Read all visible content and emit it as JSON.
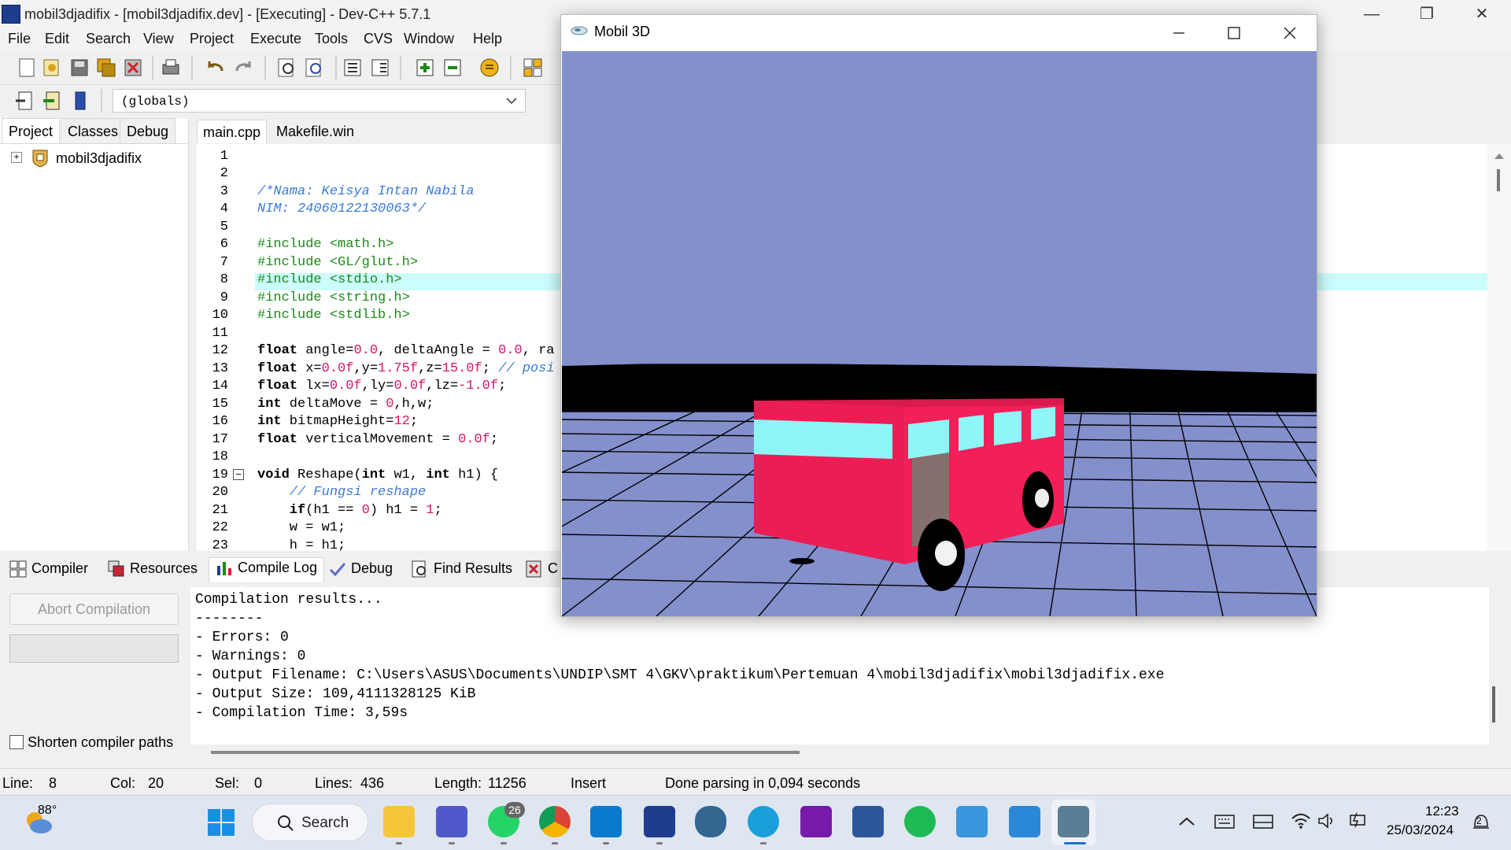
{
  "window": {
    "title": "mobil3djadifix - [mobil3djadifix.dev] - [Executing] - Dev-C++ 5.7.1",
    "minimize_glyph": "—",
    "restore_glyph": "❐",
    "close_glyph": "✕"
  },
  "menu": [
    "File",
    "Edit",
    "Search",
    "View",
    "Project",
    "Execute",
    "Tools",
    "CVS",
    "Window",
    "Help"
  ],
  "toolbar": {
    "globals_value": "(globals)"
  },
  "left_tabs": [
    "Project",
    "Classes",
    "Debug"
  ],
  "project_tree": {
    "root": "mobil3djadifix"
  },
  "editor_tabs": [
    "main.cpp",
    "Makefile.win"
  ],
  "code": {
    "line_numbers": [
      "1",
      "2",
      "3",
      "4",
      "5",
      "6",
      "7",
      "8",
      "9",
      "10",
      "11",
      "12",
      "13",
      "14",
      "15",
      "16",
      "17",
      "18",
      "19",
      "20",
      "21",
      "22",
      "23"
    ],
    "l3": "/*Nama: Keisya Intan Nabila",
    "l4": "NIM: 24060122130063*/",
    "l6": "#include <math.h>",
    "l7": "#include <GL/glut.h>",
    "l8": "#include <stdio.h>",
    "l9": "#include <string.h>",
    "l10": "#include <stdlib.h>",
    "l12a": "float",
    "l12b": " angle=",
    "l12c": "0.0",
    "l12d": ", deltaAngle = ",
    "l12e": "0.0",
    "l12f": ", ra",
    "l13a": "float",
    "l13b": " x=",
    "l13c": "0.0f",
    "l13d": ",y=",
    "l13e": "1.75f",
    "l13f": ",z=",
    "l13g": "15.0f",
    "l13h": "; ",
    "l13i": "// posi",
    "l14a": "float",
    "l14b": " lx=",
    "l14c": "0.0f",
    "l14d": ",ly=",
    "l14e": "0.0f",
    "l14f": ",lz=",
    "l14g": "-1.0f",
    "l14h": ";",
    "l15a": "int",
    "l15b": " deltaMove = ",
    "l15c": "0",
    "l15d": ",h,w;",
    "l16a": "int",
    "l16b": " bitmapHeight=",
    "l16c": "12",
    "l16d": ";",
    "l17a": "float",
    "l17b": " verticalMovement = ",
    "l17c": "0.0f",
    "l17d": ";",
    "l19a": "void",
    "l19b": " Reshape(",
    "l19c": "int",
    "l19d": " w1, ",
    "l19e": "int",
    "l19f": " h1) {",
    "l20": "    // Fungsi reshape",
    "l21a": "    if",
    "l21b": "(h1 == ",
    "l21c": "0",
    "l21d": ") h1 = ",
    "l21e": "1",
    "l21f": ";",
    "l22": "    w = w1;",
    "l23": "    h = h1;"
  },
  "bottom_tabs": [
    "Compiler",
    "Resources",
    "Compile Log",
    "Debug",
    "Find Results",
    "C"
  ],
  "bottom_panel": {
    "abort_label": "Abort Compilation",
    "shorten_label": "Shorten compiler paths",
    "log": [
      "Compilation results...",
      "--------",
      "- Errors: 0",
      "- Warnings: 0",
      "- Output Filename: C:\\Users\\ASUS\\Documents\\UNDIP\\SMT 4\\GKV\\praktikum\\Pertemuan 4\\mobil3djadifix\\mobil3djadifix.exe",
      "- Output Size: 109,4111328125 KiB",
      "- Compilation Time: 3,59s"
    ]
  },
  "status": {
    "line_label": "Line:",
    "line_value": "8",
    "col_label": "Col:",
    "col_value": "20",
    "sel_label": "Sel:",
    "sel_value": "0",
    "lines_label": "Lines:",
    "lines_value": "436",
    "length_label": "Length:",
    "length_value": "11256",
    "mode": "Insert",
    "message": "Done parsing in 0,094 seconds"
  },
  "gl_window": {
    "title": "Mobil 3D",
    "sky_color": "#8390cc",
    "bus_color": "#ec1d55",
    "window_color": "#8ff6f7"
  },
  "taskbar": {
    "weather_temp": "88°",
    "search_label": "Search",
    "whatsapp_badge": "26",
    "time": "12:23",
    "date": "25/03/2024",
    "notification_count": "2"
  }
}
